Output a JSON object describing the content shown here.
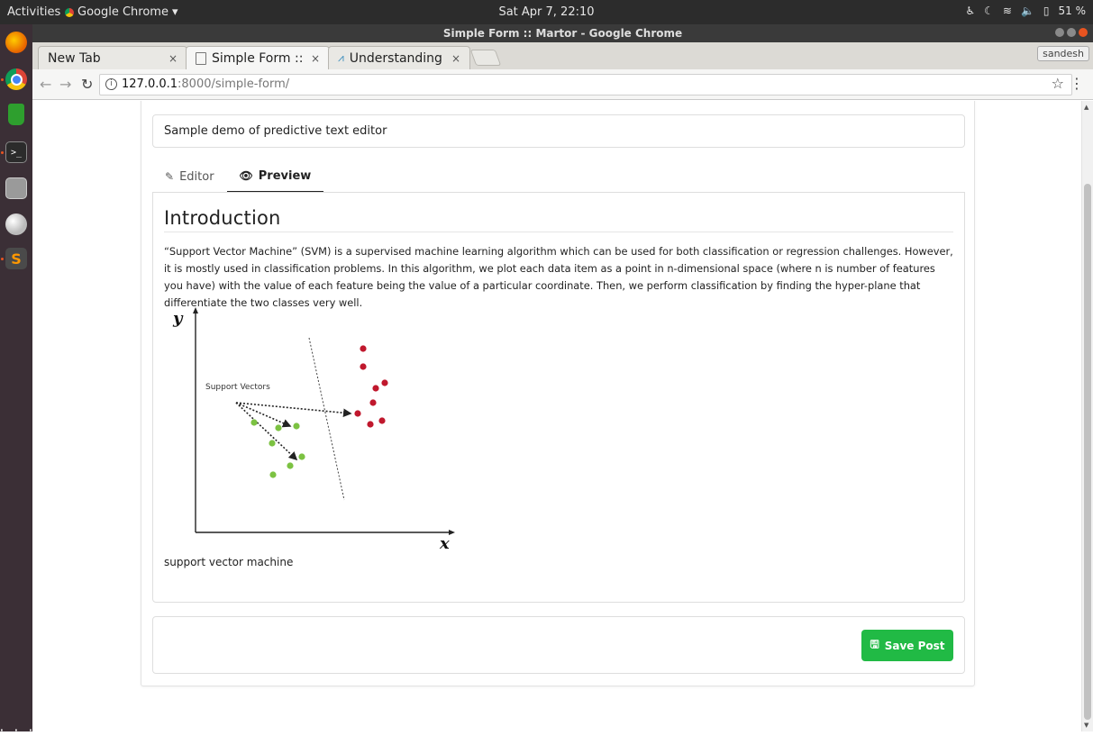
{
  "topbar": {
    "activities": "Activities",
    "app_name": "Google Chrome",
    "app_menu_arrow": "▾",
    "clock": "Sat Apr  7, 22:10",
    "battery": "51 %"
  },
  "window": {
    "title": "Simple Form :: Martor - Google Chrome"
  },
  "browser": {
    "tabs": [
      {
        "title": "New Tab",
        "close": "×"
      },
      {
        "title": "Simple Form :: Martor",
        "close": "×"
      },
      {
        "title": "Understanding Support",
        "close": "×"
      }
    ],
    "profile": "sandesh",
    "url_host": "127.0.0.1",
    "url_path": ":8000/simple-form/"
  },
  "page": {
    "title_field_value": "Sample demo of predictive  text editor",
    "tabs": {
      "editor": "Editor",
      "preview": "Preview"
    },
    "preview": {
      "heading": "Introduction",
      "paragraph": "“Support Vector Machine” (SVM) is a supervised machine learning algorithm which can be used for both classification or regression challenges. However, it is mostly used in classification problems. In this algorithm, we plot each data item as a point in n-dimensional space (where n is number of features you have) with the value of each feature being the value of a particular coordinate. Then, we perform classification by finding the hyper-plane that differentiate the two classes very well.",
      "image": {
        "y_label": "y",
        "x_label": "x",
        "annotation": "Support Vectors",
        "green_color": "#7cc242",
        "red_color": "#c0182d"
      },
      "caption": "support vector machine"
    },
    "save_button": "Save Post",
    "accent_color": "#21ba45"
  }
}
